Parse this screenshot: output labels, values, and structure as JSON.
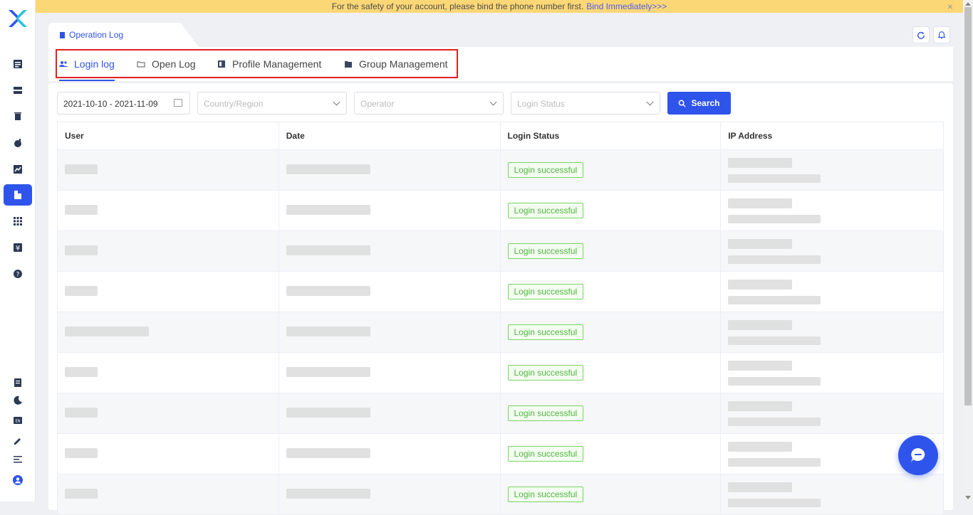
{
  "banner": {
    "message": "For the safety of your account, please bind the phone number first.",
    "link": "Bind Immediately>>>",
    "close": "×"
  },
  "page_tab": {
    "label": "Operation Log"
  },
  "tabs": [
    {
      "label": "Login log",
      "icon": "users-icon",
      "active": true
    },
    {
      "label": "Open Log",
      "icon": "folder-icon",
      "active": false
    },
    {
      "label": "Profile Management",
      "icon": "profile-icon",
      "active": false
    },
    {
      "label": "Group Management",
      "icon": "group-folder-icon",
      "active": false
    }
  ],
  "filters": {
    "date_range": "2021-10-10 - 2021-11-09",
    "country_placeholder": "Country/Region",
    "operator_placeholder": "Operator",
    "status_placeholder": "Login Status",
    "search_label": "Search"
  },
  "table": {
    "headers": [
      "User",
      "Date",
      "Login Status",
      "IP Address"
    ],
    "rows": [
      {
        "status": "Login successful"
      },
      {
        "status": "Login successful"
      },
      {
        "status": "Login successful"
      },
      {
        "status": "Login successful"
      },
      {
        "status": "Login successful"
      },
      {
        "status": "Login successful"
      },
      {
        "status": "Login successful"
      },
      {
        "status": "Login successful"
      },
      {
        "status": "Login successful"
      }
    ]
  },
  "colors": {
    "accent": "#2f54eb",
    "banner": "#fcd775",
    "success": "#52b442",
    "highlight": "#e02020"
  }
}
